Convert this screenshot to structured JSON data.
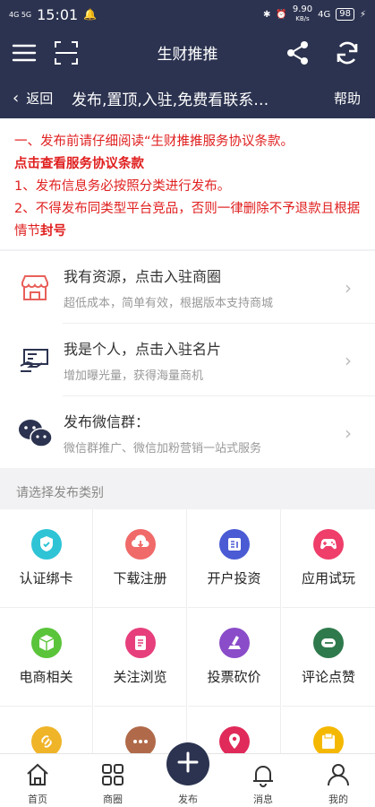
{
  "status": {
    "signal_left": "4G 5G",
    "time": "15:01",
    "speed": "9.90",
    "speed_unit": "KB/s",
    "network": "4G",
    "battery": "98"
  },
  "navbar": {
    "title": "生财推推"
  },
  "subbar": {
    "back_label": "返回",
    "title": "发布,置顶,入驻,免费看联系…",
    "help_label": "帮助"
  },
  "notice": {
    "line1": "一、发布前请仔细阅读“生财推推服务协议条款。",
    "link": "点击查看服务协议条款",
    "line2": "1、发布信息务必按照分类进行发布。",
    "line3_prefix": "2、不得发布同类型平台竞品，否则一律删除不予退款且根据情节",
    "line3_bold": "封号"
  },
  "entries": [
    {
      "title": "我有资源，点击入驻商圈",
      "desc": "超低成本，简单有效，根据版本支持商城"
    },
    {
      "title": "我是个人，点击入驻名片",
      "desc": "增加曝光量，获得海量商机"
    },
    {
      "title": "发布微信群：",
      "desc": "微信群推广、微信加粉营销一站式服务"
    }
  ],
  "category_label": "请选择发布类别",
  "categories": [
    {
      "label": "认证绑卡",
      "icon": "shield-icon",
      "color": "#2ec4d6"
    },
    {
      "label": "下载注册",
      "icon": "cloud-download-icon",
      "color": "#f06a6a"
    },
    {
      "label": "开户投资",
      "icon": "id-card-icon",
      "color": "#4a5bd4"
    },
    {
      "label": "应用试玩",
      "icon": "gamepad-icon",
      "color": "#ef3e6a"
    },
    {
      "label": "电商相关",
      "icon": "box-icon",
      "color": "#5ac43a"
    },
    {
      "label": "关注浏览",
      "icon": "document-icon",
      "color": "#e63f7c"
    },
    {
      "label": "投票砍价",
      "icon": "vote-icon",
      "color": "#8a4cc9"
    },
    {
      "label": "评论点赞",
      "icon": "comment-icon",
      "color": "#2f7a4c"
    },
    {
      "label": "",
      "icon": "link-icon",
      "color": "#f0b429"
    },
    {
      "label": "",
      "icon": "more-icon",
      "color": "#b06a4a"
    },
    {
      "label": "",
      "icon": "location-icon",
      "color": "#e02a5a"
    },
    {
      "label": "",
      "icon": "folder-icon",
      "color": "#f5b800"
    }
  ],
  "tabs": [
    {
      "label": "首页",
      "icon": "home-icon"
    },
    {
      "label": "商圈",
      "icon": "grid-icon"
    },
    {
      "label": "发布",
      "icon": "plus-icon"
    },
    {
      "label": "消息",
      "icon": "bell-icon"
    },
    {
      "label": "我的",
      "icon": "user-icon"
    }
  ]
}
